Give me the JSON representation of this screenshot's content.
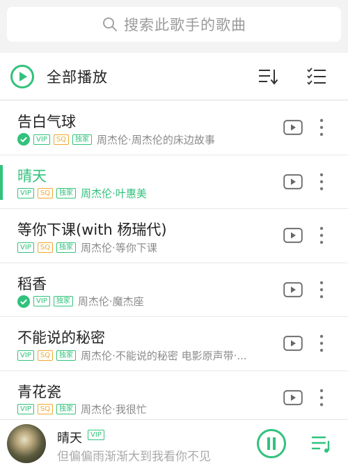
{
  "search": {
    "placeholder": "搜索此歌手的歌曲"
  },
  "header": {
    "play_all_label": "全部播放"
  },
  "songs": [
    {
      "title": "告白气球",
      "downloaded": true,
      "vip": "VIP",
      "sq": "SQ",
      "exclusive": "独家",
      "artist": "周杰伦·周杰伦的床边故事",
      "active": false
    },
    {
      "title": "晴天",
      "downloaded": false,
      "vip": "VIP",
      "sq": "SQ",
      "exclusive": "独家",
      "artist": "周杰伦·叶惠美",
      "active": true
    },
    {
      "title": "等你下课(with 杨瑞代)",
      "downloaded": false,
      "vip": "VIP",
      "sq": "SQ",
      "exclusive": "独家",
      "artist": "周杰伦·等你下课",
      "active": false
    },
    {
      "title": "稻香",
      "downloaded": true,
      "vip": "VIP",
      "sq": "",
      "exclusive": "独家",
      "artist": "周杰伦·魔杰座",
      "active": false
    },
    {
      "title": "不能说的秘密",
      "downloaded": false,
      "vip": "VIP",
      "sq": "SQ",
      "exclusive": "独家",
      "artist": "周杰伦·不能说的秘密 电影原声带·...",
      "active": false
    },
    {
      "title": "青花瓷",
      "downloaded": false,
      "vip": "VIP",
      "sq": "SQ",
      "exclusive": "独家",
      "artist": "周杰伦·我很忙",
      "active": false
    }
  ],
  "player": {
    "title": "晴天",
    "vip": "VIP",
    "lyric": "但偏偏雨渐渐大到我看你不见"
  },
  "colors": {
    "accent": "#31c27c",
    "sq": "#f0a830"
  },
  "icons": {
    "search": "search-icon",
    "play_all": "play-circle-icon",
    "sort": "sort-icon",
    "multi_select": "multi-select-icon",
    "downloaded": "check-circle-icon",
    "mv": "mv-play-icon",
    "more": "more-vertical-icon",
    "pause": "pause-circle-icon",
    "playlist": "playlist-icon"
  }
}
